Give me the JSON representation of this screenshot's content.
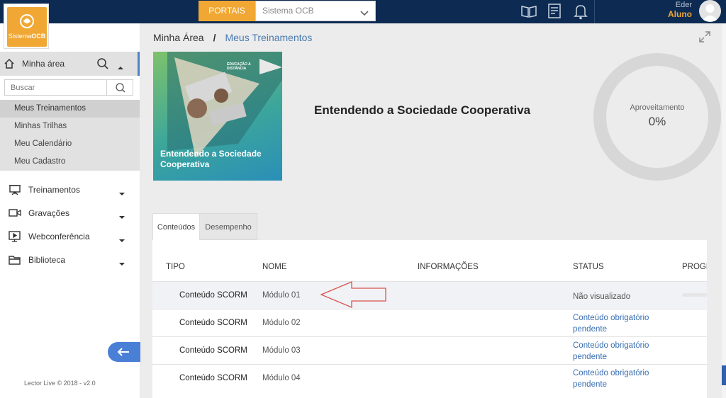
{
  "brand": {
    "logo_text_a": "Sistema",
    "logo_text_b": "OCB"
  },
  "top": {
    "portais_label": "PORTAIS",
    "portais_selected": "Sistema OCB",
    "user_name": "Eder",
    "user_role": "Aluno"
  },
  "sidebar": {
    "section_label": "Minha área",
    "search_placeholder": "Buscar",
    "sub_items": [
      {
        "label": "Meus Treinamentos"
      },
      {
        "label": "Minhas Trilhas"
      },
      {
        "label": "Meu Calendário"
      },
      {
        "label": "Meu Cadastro"
      }
    ],
    "nav": [
      {
        "label": "Treinamentos",
        "icon": "presentation-icon"
      },
      {
        "label": "Gravações",
        "icon": "video-camera-icon"
      },
      {
        "label": "Webconferência",
        "icon": "screen-play-icon"
      },
      {
        "label": "Biblioteca",
        "icon": "folder-icon"
      }
    ],
    "footer": "Lector Live © 2018 - v2.0"
  },
  "breadcrumb": {
    "root": "Minha Área",
    "separator": "/",
    "current": "Meus Treinamentos"
  },
  "course": {
    "title": "Entendendo a Sociedade Cooperativa",
    "thumbnail_title": "Entendendo a Sociedade Cooperativa",
    "thumbnail_line1": "Entendendo a Sociedade",
    "thumbnail_line2": "Cooperativa",
    "thumb_badge": "EDUCAÇÃO A DISTÂNCIA",
    "aproveitamento_label": "Aproveitamento",
    "aproveitamento_value": "0%"
  },
  "tabs": [
    {
      "label": "Conteúdos"
    },
    {
      "label": "Desempenho"
    }
  ],
  "table": {
    "headers": {
      "tipo": "TIPO",
      "nome": "NOME",
      "info": "INFORMAÇÕES",
      "status": "STATUS",
      "prog": "PROGRESSO"
    },
    "rows": [
      {
        "tipo": "Conteúdo SCORM",
        "nome": "Módulo 01",
        "status": "Não visualizado",
        "progress": 0
      },
      {
        "tipo": "Conteúdo SCORM",
        "nome": "Módulo 02",
        "status": "Conteúdo obrigatório pendente"
      },
      {
        "tipo": "Conteúdo SCORM",
        "nome": "Módulo 03",
        "status": "Conteúdo obrigatório pendente"
      },
      {
        "tipo": "Conteúdo SCORM",
        "nome": "Módulo 04",
        "status": "Conteúdo obrigatório pendente"
      }
    ]
  },
  "colors": {
    "topbar": "#0d2b52",
    "accent": "#f0a733",
    "link": "#3a6fb2",
    "annotation_arrow": "#d9534f"
  }
}
